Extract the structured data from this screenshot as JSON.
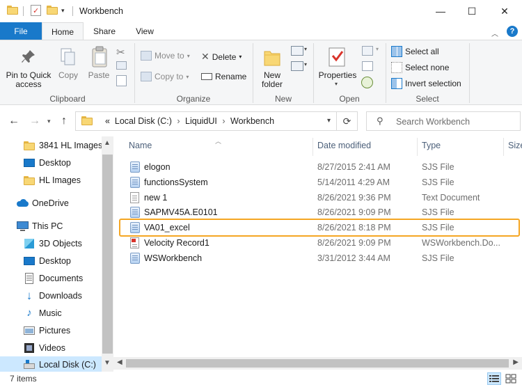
{
  "window": {
    "title": "Workbench",
    "minimize_glyph": "—",
    "maximize_glyph": "☐",
    "close_glyph": "✕"
  },
  "ribbon_tabs": {
    "file": "File",
    "home": "Home",
    "share": "Share",
    "view": "View"
  },
  "ribbon": {
    "clipboard": {
      "group_label": "Clipboard",
      "pin_label": "Pin to Quick access",
      "copy_label": "Copy",
      "paste_label": "Paste"
    },
    "organize": {
      "group_label": "Organize",
      "move_to": "Move to",
      "copy_to": "Copy to",
      "delete": "Delete",
      "rename": "Rename"
    },
    "new": {
      "group_label": "New",
      "new_folder": "New folder"
    },
    "open": {
      "group_label": "Open",
      "properties": "Properties"
    },
    "select": {
      "group_label": "Select",
      "select_all": "Select all",
      "select_none": "Select none",
      "invert_selection": "Invert selection"
    }
  },
  "address": {
    "prefix": "«",
    "crumbs": [
      "Local Disk (C:)",
      "LiquidUI",
      "Workbench"
    ],
    "separator": "›"
  },
  "search": {
    "placeholder": "Search Workbench"
  },
  "nav_pane": {
    "items": [
      {
        "label": "3841 HL Images",
        "icon": "folder-icon"
      },
      {
        "label": "Desktop",
        "icon": "desktop-icon"
      },
      {
        "label": "HL Images",
        "icon": "folder-icon"
      },
      {
        "label": "OneDrive",
        "icon": "cloud-icon"
      },
      {
        "label": "This PC",
        "icon": "computer-icon"
      },
      {
        "label": "3D Objects",
        "icon": "cube-icon"
      },
      {
        "label": "Desktop",
        "icon": "desktop-icon"
      },
      {
        "label": "Documents",
        "icon": "documents-icon"
      },
      {
        "label": "Downloads",
        "icon": "download-icon"
      },
      {
        "label": "Music",
        "icon": "music-icon"
      },
      {
        "label": "Pictures",
        "icon": "pictures-icon"
      },
      {
        "label": "Videos",
        "icon": "videos-icon"
      },
      {
        "label": "Local Disk (C:)",
        "icon": "drive-icon"
      }
    ]
  },
  "file_list": {
    "columns": [
      "Name",
      "Date modified",
      "Type",
      "Size"
    ],
    "rows": [
      {
        "name": "elogon",
        "date": "8/27/2015 2:41 AM",
        "type": "SJS File",
        "icon": "sjs-file-icon"
      },
      {
        "name": "functionsSystem",
        "date": "5/14/2011 4:29 AM",
        "type": "SJS File",
        "icon": "sjs-file-icon"
      },
      {
        "name": "new 1",
        "date": "8/26/2021 9:36 PM",
        "type": "Text Document",
        "icon": "text-file-icon"
      },
      {
        "name": "SAPMV45A.E0101",
        "date": "8/26/2021 9:09 PM",
        "type": "SJS File",
        "icon": "sjs-file-icon"
      },
      {
        "name": "VA01_excel",
        "date": "8/26/2021 8:18 PM",
        "type": "SJS File",
        "icon": "sjs-file-icon"
      },
      {
        "name": "Velocity Record1",
        "date": "8/26/2021 9:09 PM",
        "type": "WSWorkbench.Do...",
        "icon": "workbench-file-icon"
      },
      {
        "name": "WSWorkbench",
        "date": "3/31/2012 3:44 AM",
        "type": "SJS File",
        "icon": "sjs-file-icon"
      }
    ],
    "highlighted_row": "VA01_excel",
    "highlight_color": "#f5a623"
  },
  "status": {
    "item_count": "7 items"
  },
  "colors": {
    "accent": "#1979ca",
    "selection": "#cce8ff"
  }
}
